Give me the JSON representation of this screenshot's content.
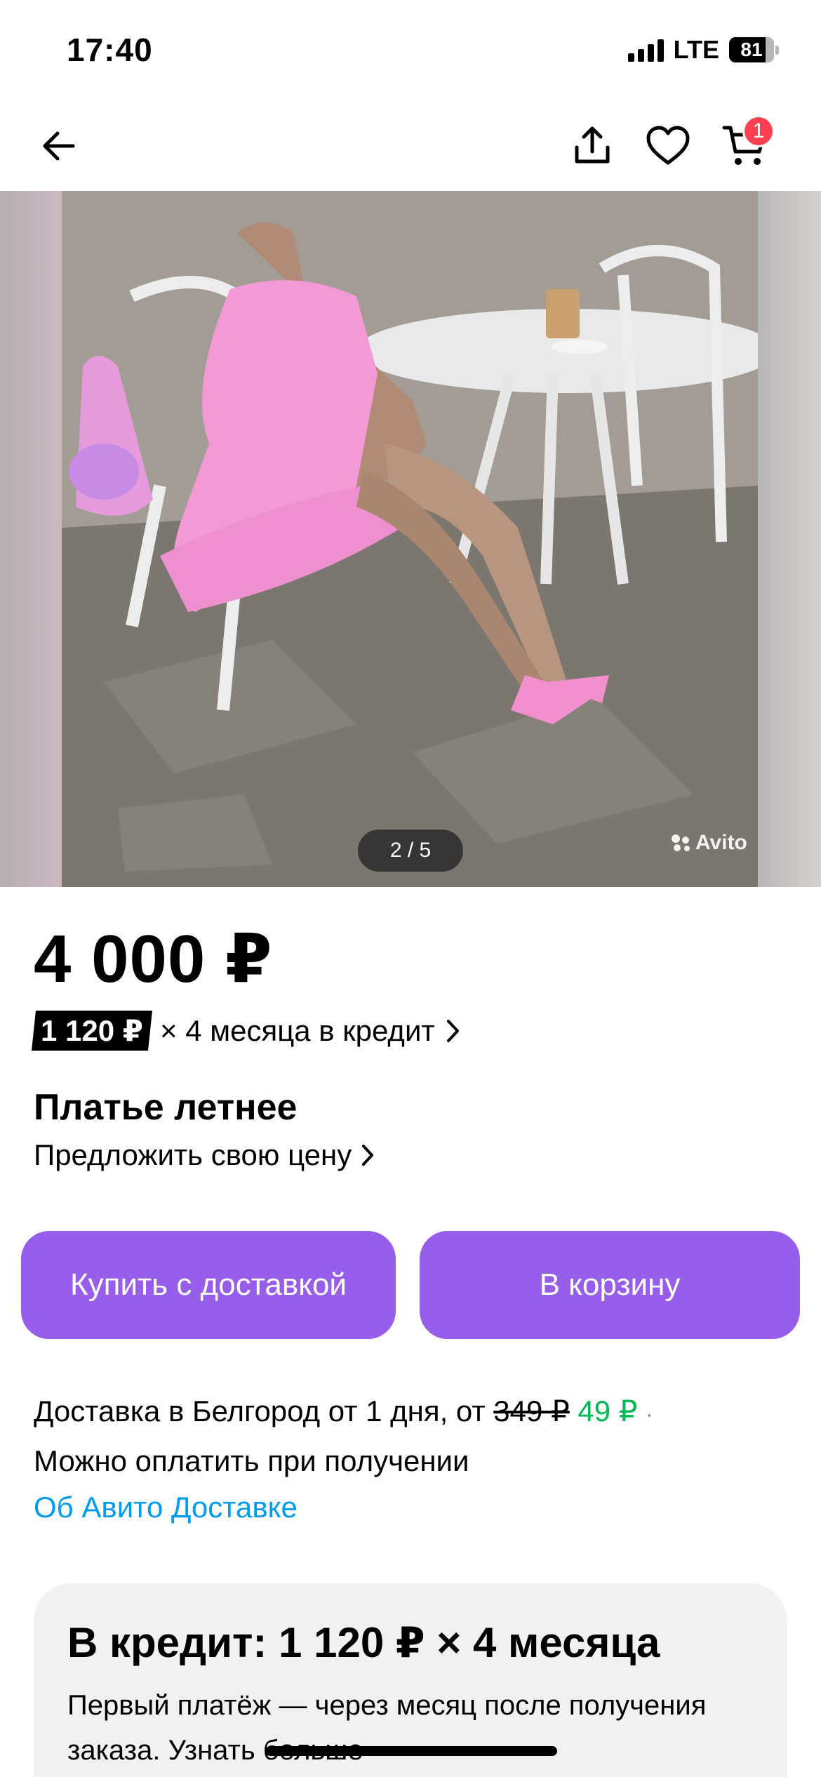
{
  "status_bar": {
    "time": "17:40",
    "network": "LTE",
    "battery": "81",
    "battery_level": 0.81
  },
  "nav": {
    "back_icon": "arrow-left-icon",
    "share_icon": "share-icon",
    "favorite_icon": "heart-icon",
    "cart_icon": "cart-icon",
    "cart_count": "1"
  },
  "gallery": {
    "counter": "2 / 5",
    "watermark": "Avito"
  },
  "product": {
    "price": "4 000 ₽",
    "credit_monthly": "1 120 ₽",
    "credit_text": "× 4 месяца в кредит",
    "title": "Платье летнее",
    "offer_price": "Предложить свою цену"
  },
  "actions": {
    "buy_with_delivery": "Купить с доставкой",
    "add_to_cart": "В корзину"
  },
  "delivery": {
    "text": "Доставка в Белгород от 1 дня, от ",
    "old_price": "349 ₽",
    "new_price": "49 ₽",
    "separator": "·",
    "payment": "Можно оплатить при получении",
    "link": "Об Авито Доставке"
  },
  "credit_card": {
    "title": "В кредит: 1 120 ₽ × 4 месяца",
    "description": "Первый платёж — через месяц после получения заказа. Узнать больше"
  },
  "colors": {
    "accent": "#965eeb",
    "badge": "#ff4053",
    "green": "#02b956",
    "link": "#009cf0"
  }
}
